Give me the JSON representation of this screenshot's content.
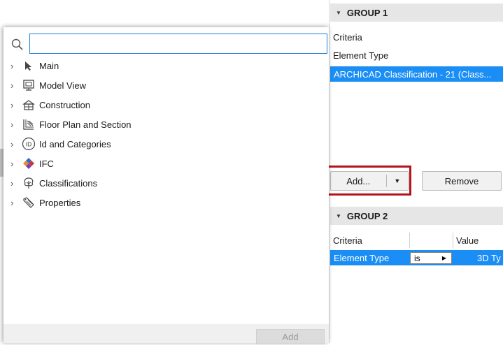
{
  "group1": {
    "title": "GROUP 1",
    "criteria_label": "Criteria",
    "element_type_label": "Element Type",
    "selected_value": "ARCHICAD Classification - 21 (Class..."
  },
  "buttons": {
    "add_label": "Add...",
    "remove_label": "Remove"
  },
  "group2": {
    "title": "GROUP 2",
    "col_criteria": "Criteria",
    "col_value": "Value",
    "row_criteria": "Element Type",
    "row_operator": "is",
    "row_value": "3D Ty"
  },
  "popup": {
    "search_value": "",
    "items": [
      {
        "label": "Main",
        "icon": "arrow-pointer-icon"
      },
      {
        "label": "Model View",
        "icon": "model-view-icon"
      },
      {
        "label": "Construction",
        "icon": "construction-icon"
      },
      {
        "label": "Floor Plan and Section",
        "icon": "floor-plan-icon"
      },
      {
        "label": "Id and Categories",
        "icon": "id-icon"
      },
      {
        "label": "IFC",
        "icon": "ifc-icon"
      },
      {
        "label": "Classifications",
        "icon": "classification-tree-icon"
      },
      {
        "label": "Properties",
        "icon": "tag-icon"
      }
    ],
    "add_label": "Add"
  },
  "colors": {
    "selection": "#1a8ef5",
    "highlight": "#b5121b",
    "search_border": "#1e7ed7"
  }
}
